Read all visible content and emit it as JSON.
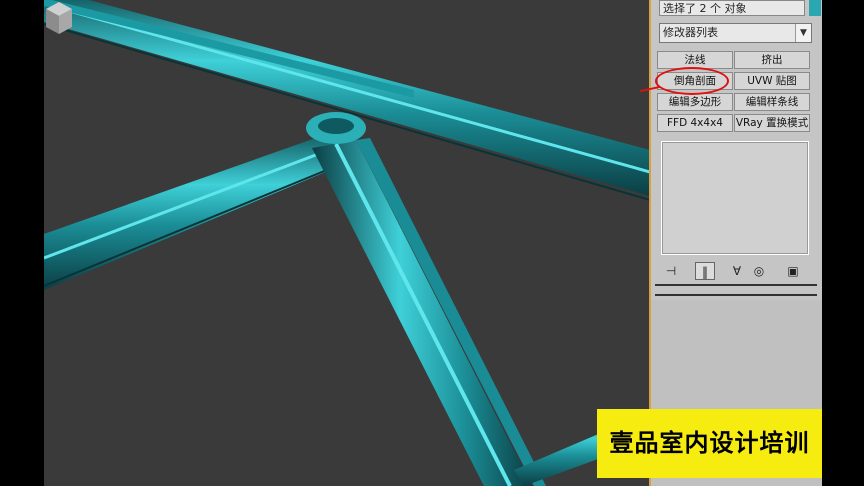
{
  "panel": {
    "selection_text": "选择了 2 个 对象",
    "modifier_list": "修改器列表",
    "buttons": [
      {
        "label": "法线"
      },
      {
        "label": "挤出"
      },
      {
        "label": "倒角剖面"
      },
      {
        "label": "UVW 贴图"
      },
      {
        "label": "编辑多边形"
      },
      {
        "label": "编辑样条线"
      },
      {
        "label": "FFD 4x4x4"
      },
      {
        "label": "VRay 置换模式"
      }
    ],
    "tools": [
      "pin-stack-icon",
      "show-end-result-icon",
      "make-unique-icon",
      "remove-modifier-icon",
      "configure-sets-icon"
    ]
  },
  "colors": {
    "object_color": "#2aa7b0",
    "viewport_bg": "#3a3a3a",
    "annotation": "#e01010",
    "banner_bg": "#f7ec10"
  },
  "banner": {
    "text": "壹品室内设计培训"
  }
}
